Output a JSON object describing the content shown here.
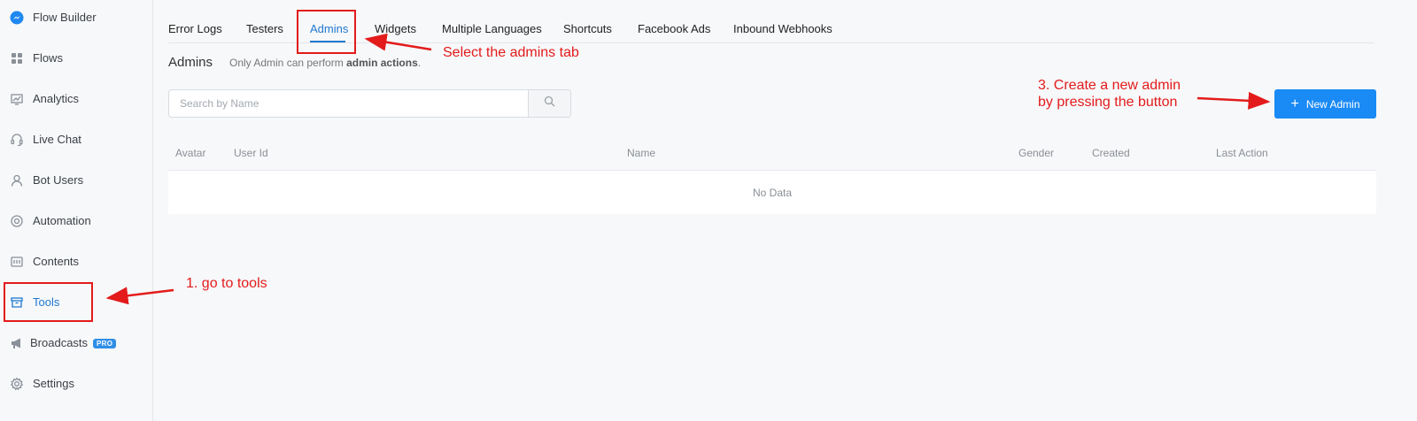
{
  "sidebar": {
    "items": [
      {
        "label": "Flow Builder",
        "icon": "messenger-icon"
      },
      {
        "label": "Flows",
        "icon": "grid-icon"
      },
      {
        "label": "Analytics",
        "icon": "chart-icon"
      },
      {
        "label": "Live Chat",
        "icon": "headset-icon"
      },
      {
        "label": "Bot Users",
        "icon": "user-icon"
      },
      {
        "label": "Automation",
        "icon": "gear-cycle-icon"
      },
      {
        "label": "Contents",
        "icon": "contents-icon"
      },
      {
        "label": "Tools",
        "icon": "box-icon"
      },
      {
        "label": "Broadcasts",
        "icon": "megaphone-icon",
        "badge": "PRO"
      },
      {
        "label": "Settings",
        "icon": "settings-icon"
      }
    ],
    "active": "Tools"
  },
  "tabs": [
    {
      "label": "Error Logs"
    },
    {
      "label": "Testers"
    },
    {
      "label": "Admins"
    },
    {
      "label": "Widgets"
    },
    {
      "label": "Multiple Languages"
    },
    {
      "label": "Shortcuts"
    },
    {
      "label": "Facebook Ads"
    },
    {
      "label": "Inbound Webhooks"
    }
  ],
  "active_tab": "Admins",
  "header": {
    "title": "Admins",
    "desc_prefix": "Only Admin can perform",
    "desc_bold": "admin actions",
    "desc_suffix": "."
  },
  "search": {
    "placeholder": "Search by Name",
    "value": ""
  },
  "new_admin_button": {
    "label": "New Admin"
  },
  "table": {
    "columns": [
      "Avatar",
      "User Id",
      "Name",
      "Gender",
      "Created",
      "Last Action"
    ],
    "empty_text": "No Data"
  },
  "annotations": {
    "step1": "1. go to tools",
    "step2": "Select the admins tab",
    "step3_line1": "3. Create a new admin",
    "step3_line2": "by pressing the button"
  },
  "colors": {
    "accent": "#1f78d1",
    "button": "#1a8af5",
    "annotation": "#e31b1b",
    "badge": "#2f8ee6"
  }
}
